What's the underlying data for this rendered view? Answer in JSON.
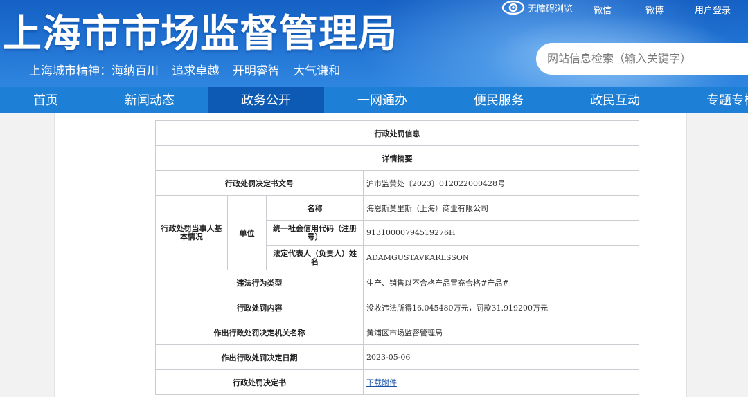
{
  "header": {
    "site_title": "上海市市场监督管理局",
    "slogan": [
      "上海城市精神：海纳百川",
      "追求卓越",
      "开明睿智",
      "大气谦和"
    ],
    "top_links": {
      "accessibility": "无障碍浏览",
      "wechat": "微信",
      "weibo": "微博",
      "login": "用户登录"
    },
    "search_placeholder": "网站信息检索（输入关键字）"
  },
  "nav": {
    "items": [
      "首页",
      "新闻动态",
      "政务公开",
      "一网通办",
      "便民服务",
      "政民互动",
      "专题专栏"
    ],
    "active_index": 2
  },
  "colors": {
    "header_blue": "#1e6fd0",
    "nav_blue": "#1d7fd6",
    "nav_active": "#0d5ab5",
    "link": "#1a52a8"
  },
  "table": {
    "title": "行政处罚信息",
    "section": "详情摘要",
    "decision_no_label": "行政处罚决定书文号",
    "decision_no_value": "沪市监黄处〔2023〕012022000428号",
    "party_label": "行政处罚当事人基本情况",
    "unit_label": "单位",
    "name_label": "名称",
    "name_value": "海恩斯莫里斯（上海）商业有限公司",
    "credit_code_label": "统一社会信用代码（注册号）",
    "credit_code_value": "91310000794519276H",
    "legal_rep_label": "法定代表人（负责人）姓名",
    "legal_rep_value": "ADAMGUSTAVKARLSSON",
    "violation_type_label": "违法行为类型",
    "violation_type_value": "生产、销售以不合格产品冒充合格#产品#",
    "penalty_content_label": "行政处罚内容",
    "penalty_content_value": "没收违法所得16.045480万元，罚款31.919200万元",
    "authority_label": "作出行政处罚决定机关名称",
    "authority_value": "黄浦区市场监督管理局",
    "date_label": "作出行政处罚决定日期",
    "date_value": "2023-05-06",
    "document_label": "行政处罚决定书",
    "document_link": "下载附件"
  }
}
